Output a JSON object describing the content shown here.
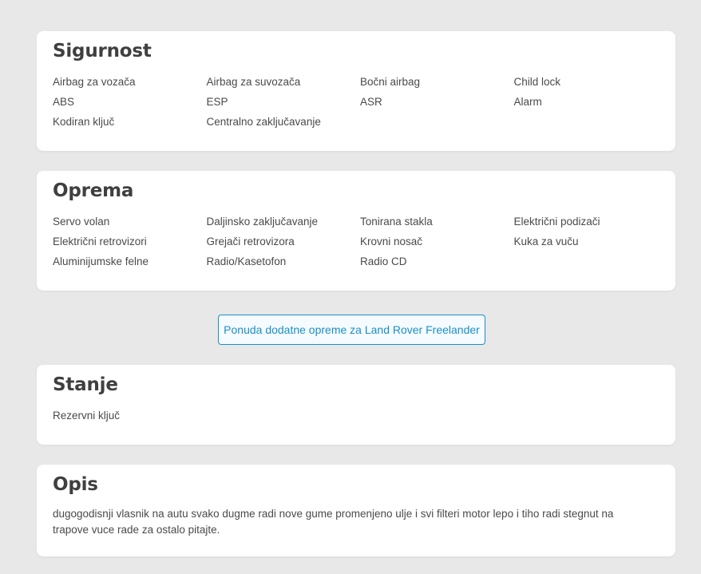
{
  "sections": {
    "security": {
      "title": "Sigurnost",
      "items": [
        "Airbag za vozača",
        "Airbag za suvozača",
        "Bočni airbag",
        "Child lock",
        "ABS",
        "ESP",
        "ASR",
        "Alarm",
        "Kodiran ključ",
        "Centralno zaključavanje"
      ]
    },
    "equipment": {
      "title": "Oprema",
      "items": [
        "Servo volan",
        "Daljinsko zaključavanje",
        "Tonirana stakla",
        "Električni podizači",
        "Električni retrovizori",
        "Grejači retrovizora",
        "Krovni nosač",
        "Kuka za vuču",
        "Aluminijumske felne",
        "Radio/Kasetofon",
        "Radio CD"
      ]
    },
    "condition": {
      "title": "Stanje",
      "items": [
        "Rezervni ključ"
      ]
    },
    "description": {
      "title": "Opis",
      "text": "dugogodisnji vlasnik na autu svako dugme radi nove gume promenjeno ulje i svi filteri motor lepo i tiho radi stegnut na trapove vuce rade za ostalo pitajte."
    }
  },
  "offer_button": {
    "label": "Ponuda dodatne opreme za Land Rover Freelander"
  },
  "colors": {
    "page_background": "#e8e8e8",
    "card_background": "#ffffff",
    "accent": "#1a8fc7",
    "heading": "#3f3f3f",
    "text": "#4a4a4a"
  }
}
